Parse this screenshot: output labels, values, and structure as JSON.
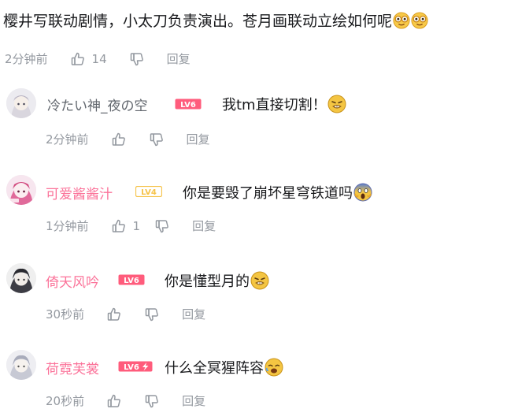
{
  "main_comment": {
    "text": "樱井写联动剧情，小太刀负责演出。苍月画联动立绘如何呢",
    "emojis": [
      "goggle-eyes-emoji",
      "goggle-eyes-emoji"
    ],
    "time": "2分钟前",
    "likes": "14",
    "reply_label": "回复"
  },
  "replies": [
    {
      "username": "冷たい神_夜の空",
      "level": "LV6",
      "text": "我tm直接切割！",
      "emoji": "cringe-face-emoji",
      "time": "2分钟前",
      "likes": "",
      "reply_label": "回复"
    },
    {
      "username": "可爱酱酱汁",
      "level": "LV4",
      "text": "你是要毁了崩坏星穹铁道吗",
      "emoji": "screaming-face-emoji",
      "time": "1分钟前",
      "likes": "1",
      "reply_label": "回复"
    },
    {
      "username": "倚天风吟",
      "level": "LV6",
      "text": "你是懂型月的",
      "emoji": "cringe-face-emoji",
      "time": "30秒前",
      "likes": "",
      "reply_label": "回复"
    },
    {
      "username": "荷霓芙裳",
      "level": "LV6⚡",
      "text": "什么全冥猩阵容",
      "emoji": "weary-face-emoji",
      "time": "20秒前",
      "likes": "",
      "reply_label": "回复"
    }
  ],
  "colors": {
    "vip_name": "#fb7299",
    "normal_name": "#61666d",
    "meta": "#9499a0",
    "lv6": "#ff5c7c",
    "lv4": "#f6c34a"
  }
}
